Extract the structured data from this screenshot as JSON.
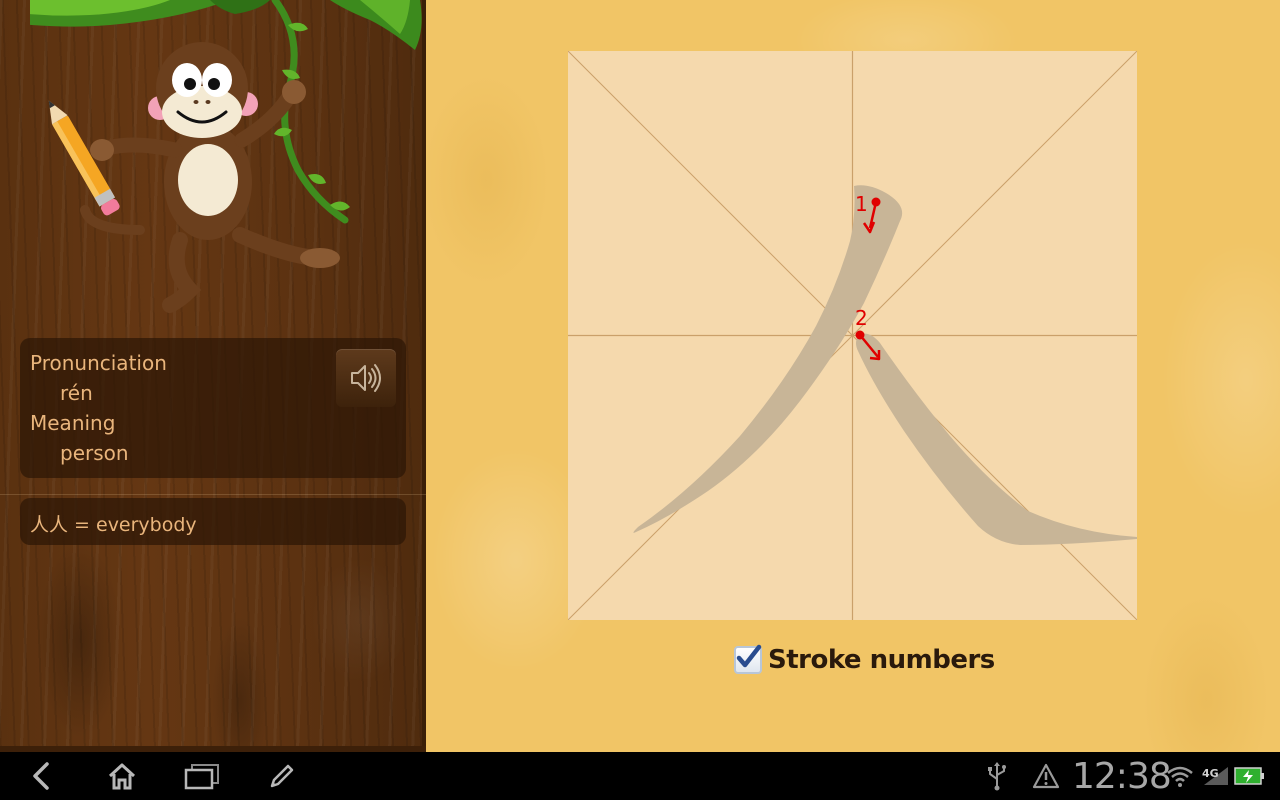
{
  "character": {
    "pronunciation_label": "Pronunciation",
    "pronunciation": "rén",
    "meaning_label": "Meaning",
    "meaning": "person",
    "example": "人人 = everybody"
  },
  "stroke_order": {
    "stroke_1_number": "1",
    "stroke_2_number": "2",
    "stroke_count": 2
  },
  "options": {
    "stroke_numbers_label": "Stroke numbers",
    "stroke_numbers_checked": true
  },
  "icons": {
    "speaker": "speaker-icon",
    "back": "back-icon",
    "home": "home-icon",
    "recents": "recent-apps-icon",
    "pencil": "pencil-icon",
    "usb": "usb-icon",
    "warning": "warning-icon",
    "wifi": "wifi-icon",
    "signal": "4g-signal-icon",
    "battery": "battery-icon"
  },
  "status_bar": {
    "time": "12:38",
    "network": "4G"
  },
  "colors": {
    "stroke_guide": "#c8b597",
    "stroke_marker": "#e00000",
    "info_text": "#e9b57c",
    "board": "#f5d9ad",
    "grid_line": "#caa06a"
  }
}
